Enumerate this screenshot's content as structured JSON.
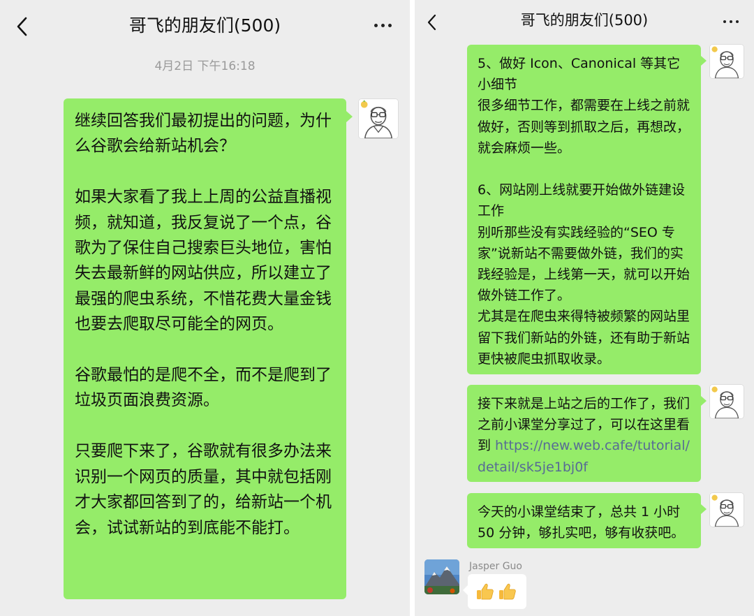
{
  "left_screen": {
    "header": {
      "back_icon": "chevron-left-icon",
      "title": "哥飞的朋友们(500)",
      "more_icon": "ellipsis-icon"
    },
    "timestamp": "4月2日 下午16:18",
    "messages": [
      {
        "sender": "self",
        "avatar_icon": "cartoon-avatar-icon",
        "text": "继续回答我们最初提出的问题，为什么谷歌会给新站机会？\n\n如果大家看了我上上周的公益直播视频，就知道，我反复说了一个点，谷歌为了保住自己搜索巨头地位，害怕失去最新鲜的网站供应，所以建立了最强的爬虫系统，不惜花费大量金钱也要去爬取尽可能全的网页。\n\n谷歌最怕的是爬不全，而不是爬到了垃圾页面浪费资源。\n\n只要爬下来了，谷歌就有很多办法来识别一个网页的质量，其中就包括刚才大家都回答到了的，给新站一个机会，试试新站的到底能不能打。"
      }
    ]
  },
  "right_screen": {
    "header": {
      "back_icon": "chevron-left-icon",
      "title": "哥飞的朋友们(500)",
      "more_icon": "ellipsis-icon"
    },
    "messages": [
      {
        "sender": "self",
        "avatar_icon": "cartoon-avatar-icon",
        "text": "5、做好 Icon、Canonical 等其它小细节\n很多细节工作，都需要在上线之前就做好，否则等到抓取之后，再想改，就会麻烦一些。\n\n6、网站刚上线就要开始做外链建设工作\n别听那些没有实践经验的“SEO 专家”说新站不需要做外链，我们的实践经验是，上线第一天，就可以开始做外链工作了。\n尤其是在爬虫来得特被频繁的网站里留下我们新站的外链，还有助于新站更快被爬虫抓取收录。"
      },
      {
        "sender": "self",
        "avatar_icon": "cartoon-avatar-icon",
        "text_before_link": "接下来就是上站之后的工作了，我们之前小课堂分享过了，可以在这里看到 ",
        "link": "https://new.web.cafe/tutorial/detail/sk5je1bj0f"
      },
      {
        "sender": "self",
        "avatar_icon": "cartoon-avatar-icon",
        "text": "今天的小课堂结束了，总共 1 小时 50 分钟，够扎实吧，够有收获吧。"
      },
      {
        "sender": "friend",
        "sender_name": "Jasper Guo",
        "avatar_icon": "mountain-photo-avatar-icon",
        "reaction_icons": [
          "thumbs-up-icon",
          "thumbs-up-icon"
        ]
      }
    ]
  },
  "colors": {
    "chat_background": "#ededed",
    "self_bubble": "#95ec69",
    "friend_bubble": "#ffffff",
    "link": "#576b95",
    "timestamp_text": "#9a9a9a"
  }
}
